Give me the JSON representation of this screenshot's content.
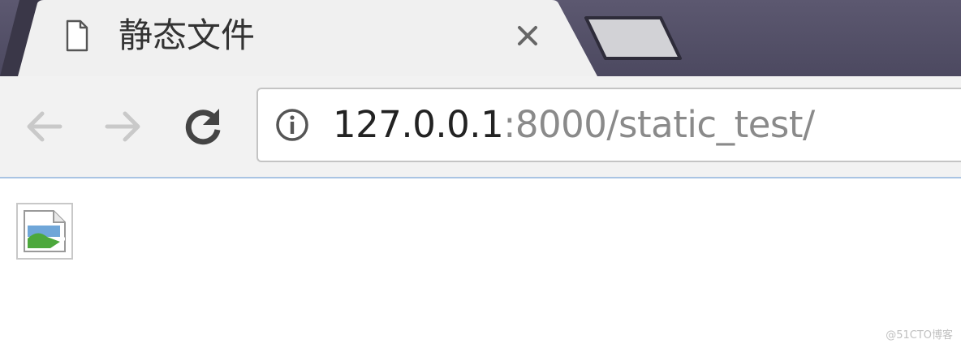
{
  "tab": {
    "title": "静态文件",
    "page_icon": "document-icon",
    "close_icon": "close-icon"
  },
  "new_tab": {
    "icon": "new-tab-button"
  },
  "toolbar": {
    "back_icon": "arrow-left-icon",
    "forward_icon": "arrow-right-icon",
    "reload_icon": "reload-icon",
    "back_enabled": false,
    "forward_enabled": false
  },
  "omnibox": {
    "security_icon": "info-icon",
    "url_host": "127.0.0.1",
    "url_rest": ":8000/static_test/"
  },
  "content": {
    "image": "broken-image-icon"
  },
  "watermark": "@51CTO博客",
  "colors": {
    "tabstrip": "#5c5870",
    "active_tab": "#f0f0f0",
    "toolbar": "#f2f2f2",
    "url_host": "#222222",
    "url_rest": "#8a8a8a"
  }
}
